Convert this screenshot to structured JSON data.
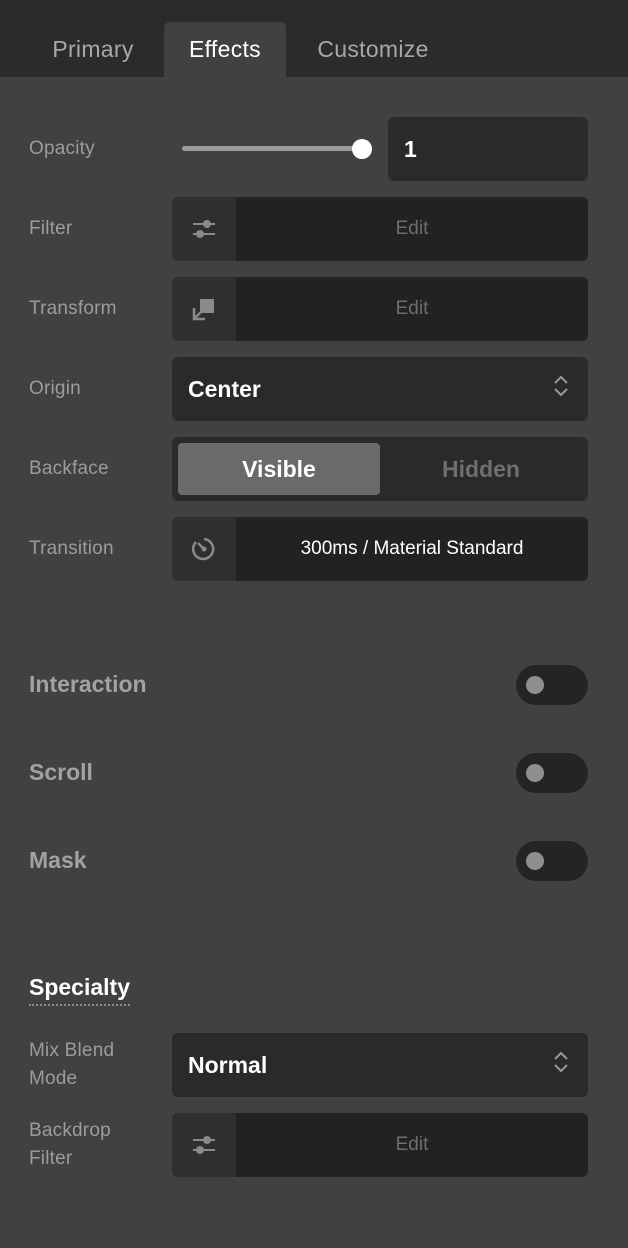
{
  "tabs": [
    {
      "label": "Primary",
      "active": false
    },
    {
      "label": "Effects",
      "active": true
    },
    {
      "label": "Customize",
      "active": false
    }
  ],
  "opacity": {
    "label": "Opacity",
    "value": "1",
    "slider_fraction": 1.0
  },
  "filter": {
    "label": "Filter",
    "icon": "sliders-icon",
    "value": "Edit"
  },
  "transform": {
    "label": "Transform",
    "icon": "transform-icon",
    "value": "Edit"
  },
  "origin": {
    "label": "Origin",
    "value": "Center",
    "icon": "updown-chevron-icon"
  },
  "backface": {
    "label": "Backface",
    "options": [
      "Visible",
      "Hidden"
    ],
    "selected": "Visible"
  },
  "transition": {
    "label": "Transition",
    "icon": "timer-icon",
    "value": "300ms / Material Standard"
  },
  "sections": {
    "interaction": {
      "label": "Interaction",
      "enabled": false
    },
    "scroll": {
      "label": "Scroll",
      "enabled": false
    },
    "mask": {
      "label": "Mask",
      "enabled": false
    }
  },
  "specialty": {
    "title": "Specialty",
    "mix_blend": {
      "label_line1": "Mix Blend",
      "label_line2": "Mode",
      "value": "Normal",
      "icon": "updown-chevron-icon"
    },
    "backdrop": {
      "label_line1": "Backdrop",
      "label_line2": "Filter",
      "icon": "sliders-icon",
      "value": "Edit"
    }
  },
  "colors": {
    "panel": "#414141",
    "topbar": "#2b2b2b",
    "field": "#2a2a2a",
    "active_segment": "#6a6a6a"
  }
}
